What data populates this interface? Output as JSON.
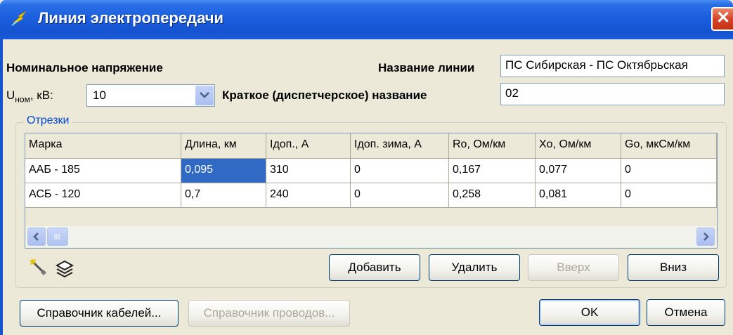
{
  "window": {
    "title": "Линия электропередачи",
    "close_symbol": "✕"
  },
  "form": {
    "nominal_voltage_heading": "Номинальное напряжение",
    "voltage_label_main": "U",
    "voltage_label_sub": "ном",
    "voltage_label_rest": ", кВ:",
    "voltage_value": "10",
    "line_name_label": "Название линии",
    "line_name_value": "ПС Сибирская - ПС Октябрьская",
    "short_name_label": "Краткое (диспетчерское) название",
    "short_name_value": "02"
  },
  "segments": {
    "group_title": "Отрезки",
    "columns": [
      "Марка",
      "Длина, км",
      "Iдоп., А",
      "Iдоп. зима, А",
      "Ro, Ом/км",
      "Xo, Ом/км",
      "Go, мкСм/км"
    ],
    "rows": [
      [
        "ААБ - 185",
        "0,095",
        "310",
        "0",
        "0,167",
        "0,077",
        "0"
      ],
      [
        "АСБ - 120",
        "0,7",
        "240",
        "0",
        "0,258",
        "0,081",
        "0"
      ]
    ],
    "tool_icons": [
      "wand-icon",
      "layers-icon"
    ],
    "buttons": {
      "add": "Добавить",
      "delete": "Удалить",
      "up": "Вверх",
      "down": "Вниз"
    }
  },
  "footer": {
    "cable_ref": "Справочник кабелей...",
    "wire_ref": "Справочник проводов...",
    "ok": "OK",
    "cancel": "Отмена"
  },
  "colors": {
    "title_bar": "#1553d0",
    "selection": "#316ac5",
    "group_title": "#0046d5",
    "close_button": "#d5452a"
  }
}
